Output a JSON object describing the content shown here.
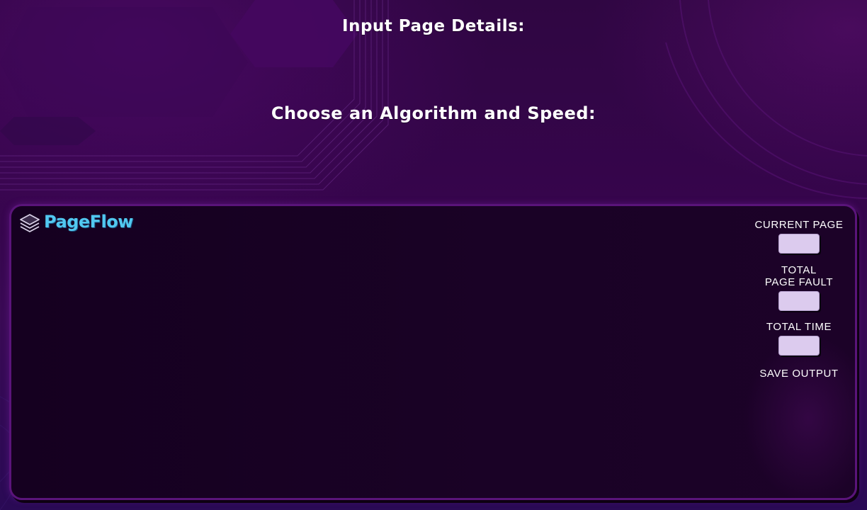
{
  "headings": {
    "input_page_details": "Input Page Details:",
    "choose_algorithm": "Choose an Algorithm and Speed:"
  },
  "logo": {
    "text": "PageFlow",
    "icon": "layers-icon",
    "color": "#52c8f0"
  },
  "stats": {
    "current_page_label": "CURRENT PAGE",
    "current_page_value": "",
    "total_page_fault_label": "TOTAL\nPAGE FAULT",
    "total_page_fault_value": "",
    "total_time_label": "TOTAL TIME",
    "total_time_value": "",
    "save_output_label": "SAVE OUTPUT"
  },
  "colors": {
    "background": "#2f0642",
    "panel": "#160020",
    "panel_border": "#5a147a",
    "stat_box": "#dccbee"
  }
}
